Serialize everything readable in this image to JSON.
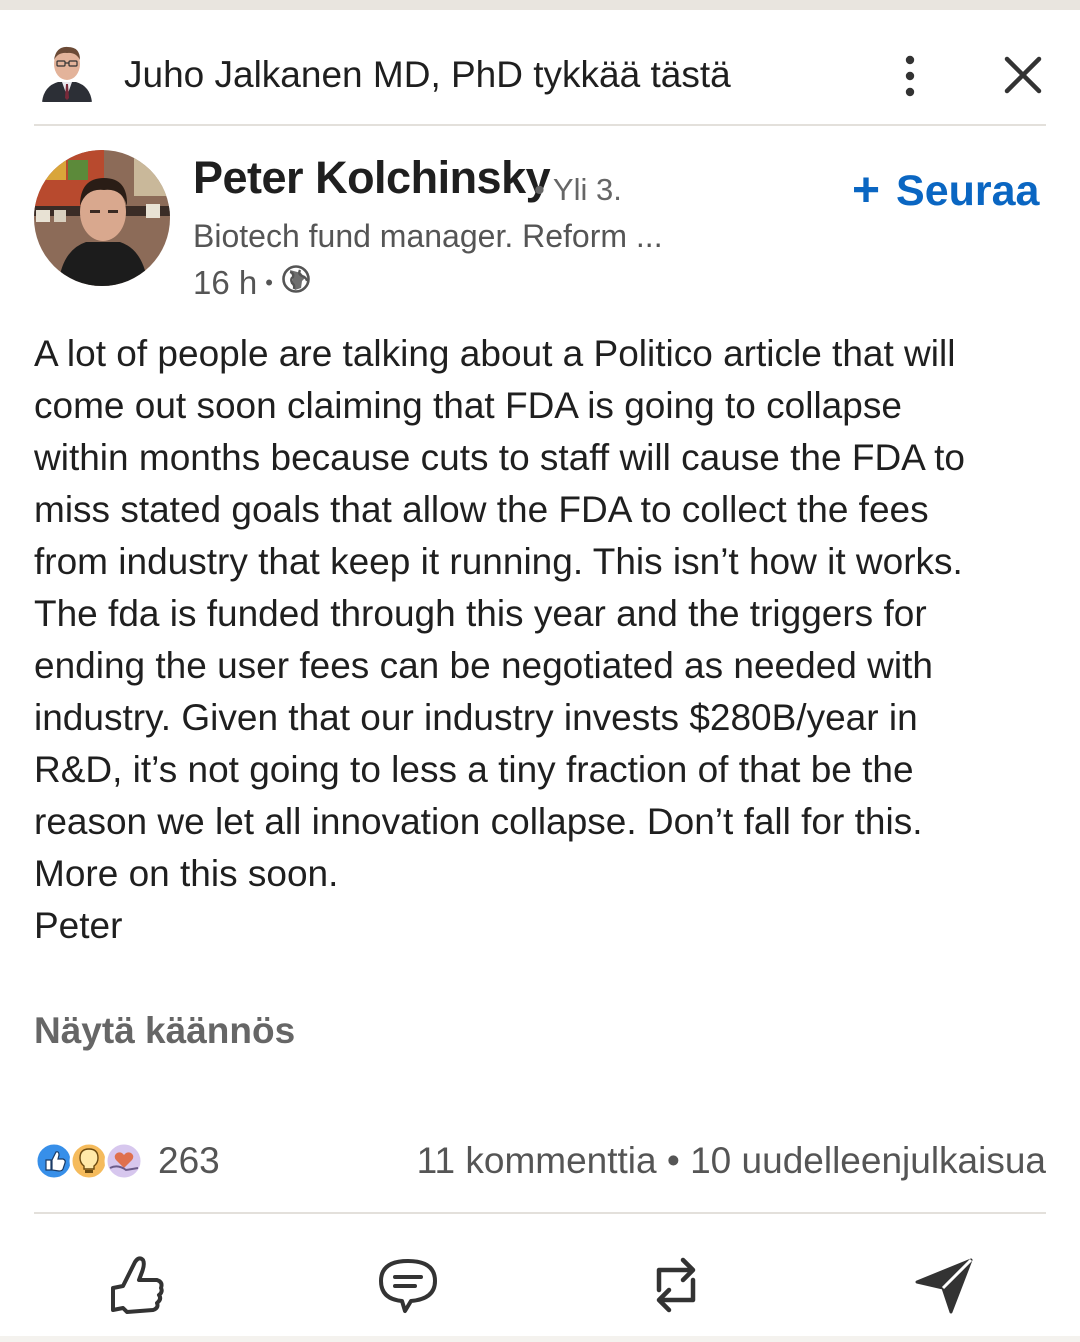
{
  "header": {
    "liker_text": "Juho Jalkanen MD, PhD tykkää tästä"
  },
  "author": {
    "name": "Peter Kolchinsky",
    "degree": "• Yli 3.",
    "headline": "Biotech fund manager. Reform ...",
    "time": "16 h",
    "separator": "•",
    "visibility_icon": "globe-icon"
  },
  "follow": {
    "plus": "+",
    "label": "Seuraa"
  },
  "post": {
    "lines": [
      "A lot of people are talking about a Politico article that will",
      "come out soon claiming that FDA is going to collapse",
      "within months because cuts to staff will cause the FDA to",
      "miss stated goals that allow the FDA to collect the fees",
      "from industry that keep it running. This isn’t how it works.",
      "The fda is funded through this year and the triggers for",
      "ending the user fees can be negotiated as needed with",
      "industry. Given that our industry invests $280B/year in",
      "R&D, it’s not going to less a tiny fraction of that be the",
      "reason we let all innovation collapse. Don’t fall for this.",
      "More on this soon.",
      "Peter"
    ],
    "translate_label": "Näytä käännös"
  },
  "social": {
    "reaction_count": "263",
    "comments_reposts": "11 kommenttia • 10 uudelleenjulkaisua"
  },
  "actions": {
    "like_icon": "thumbs-up-icon",
    "comment_icon": "comment-icon",
    "repost_icon": "repost-icon",
    "send_icon": "send-icon"
  },
  "colors": {
    "accent": "#0a66c2",
    "text": "#1f1f1f",
    "muted": "#555555",
    "background": "#ffffff"
  }
}
